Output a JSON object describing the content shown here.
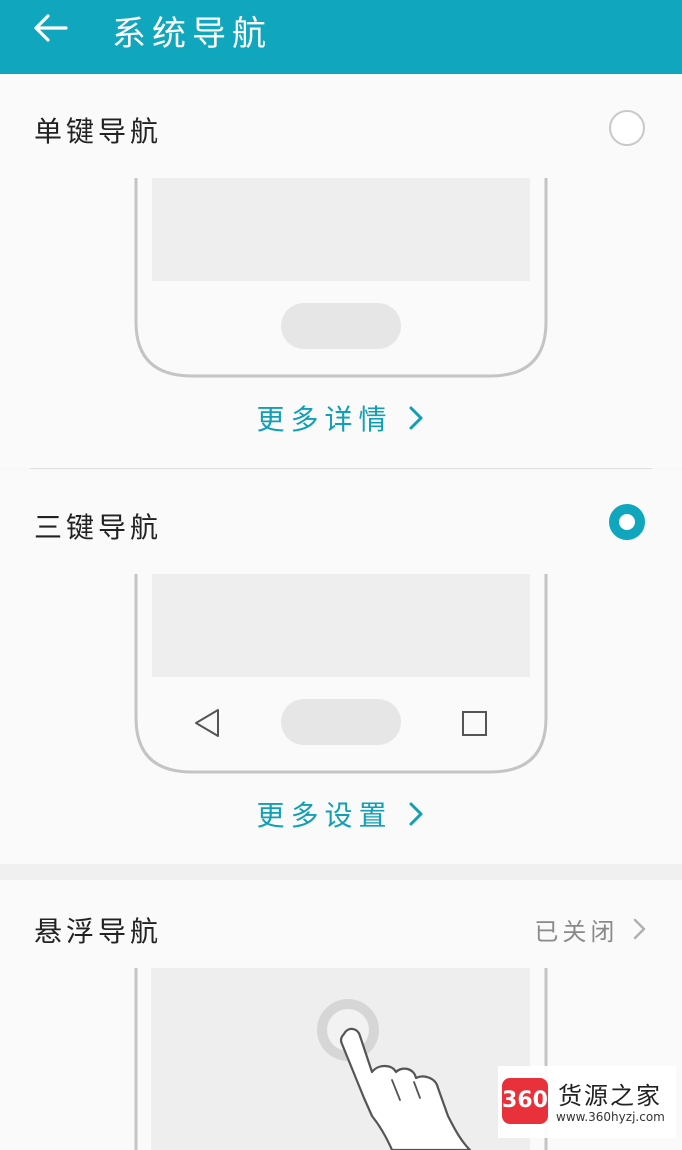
{
  "header": {
    "title": "系统导航"
  },
  "options": [
    {
      "title": "单键导航",
      "link": "更多详情",
      "selected": false
    },
    {
      "title": "三键导航",
      "link": "更多设置",
      "selected": true
    },
    {
      "title": "悬浮导航",
      "status": "已关闭"
    }
  ],
  "watermark": {
    "logo_text": "360",
    "name": "货源之家",
    "url": "www.360hyzj.com"
  },
  "colors": {
    "accent": "#10a6bd",
    "link": "#109fb4",
    "illustration_stroke": "#c4c4c4"
  }
}
